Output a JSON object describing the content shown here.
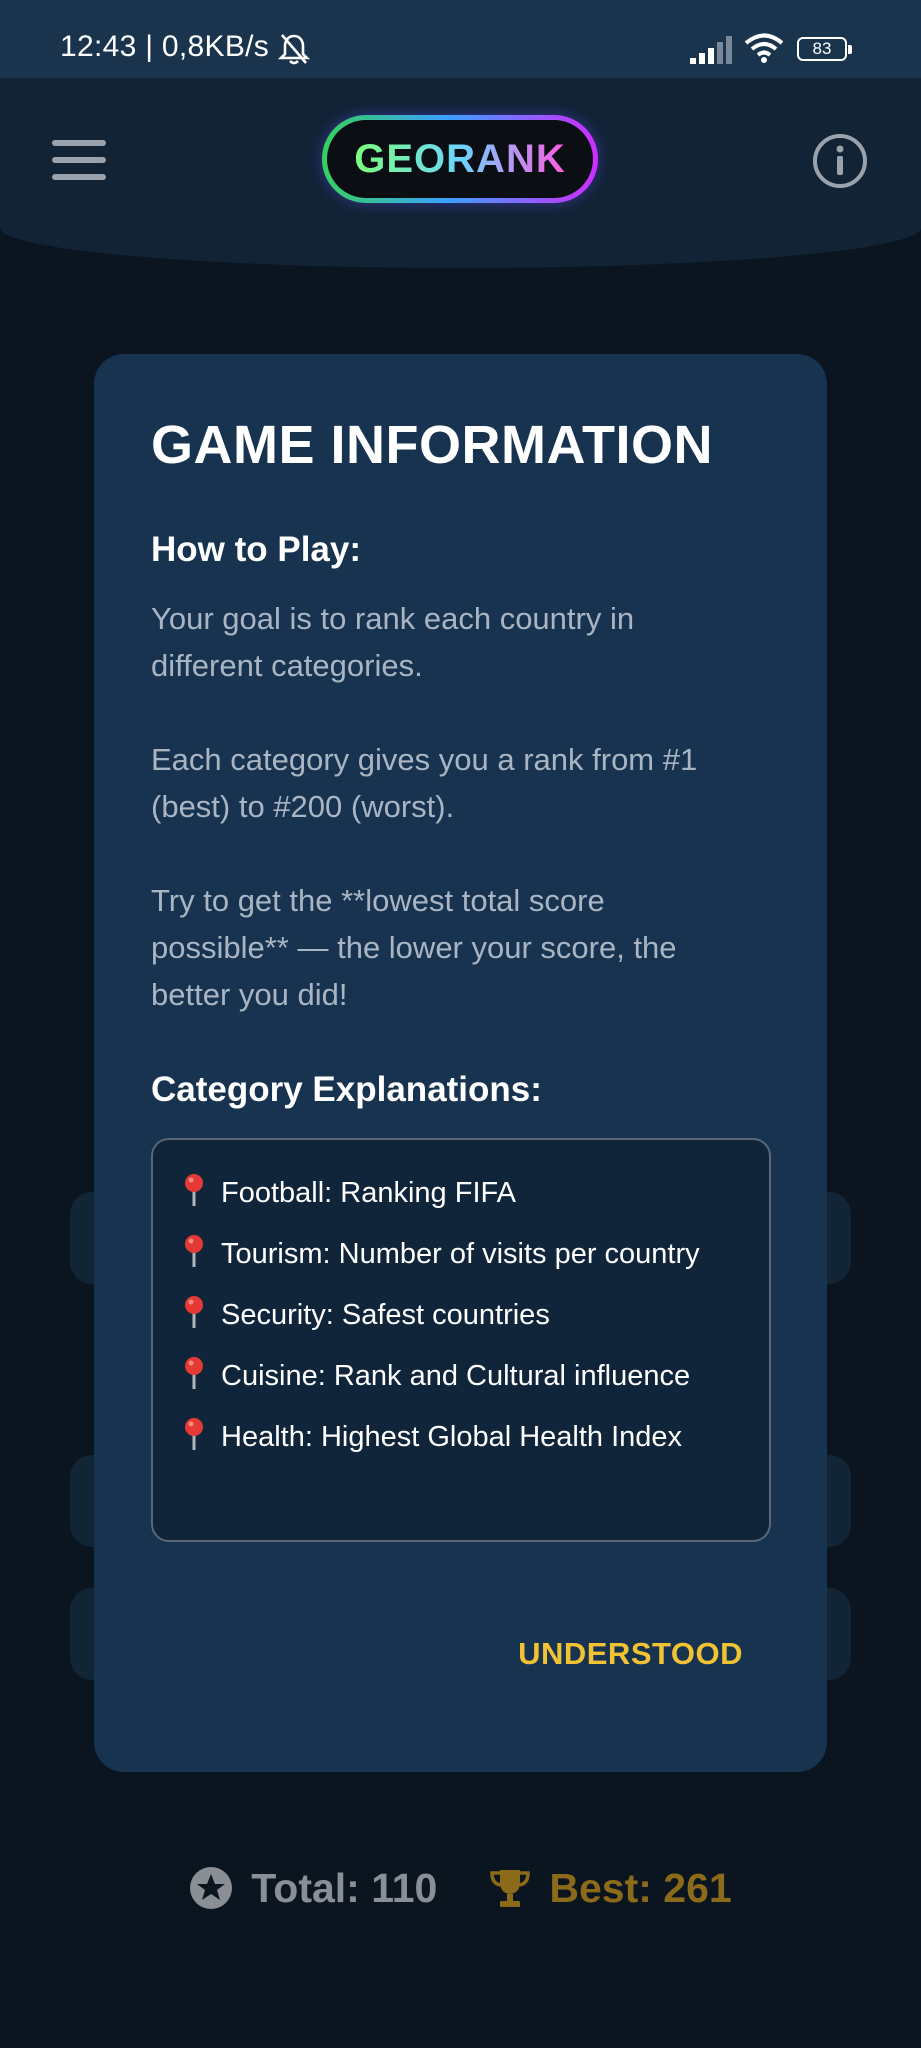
{
  "status_bar": {
    "time_speed": "12:43 | 0,8KB/s",
    "battery": "83"
  },
  "header": {
    "logo_text": "GEORANK"
  },
  "dialog": {
    "title": "GAME INFORMATION",
    "how_to_play_heading": "How to Play:",
    "paragraphs": [
      "Your goal is to rank each country in different categories.",
      "Each category gives you a rank from #1 (best) to #200 (worst).",
      "Try to get the **lowest total score possible** — the lower your score, the better you did!"
    ],
    "categories_heading": "Category Explanations:",
    "categories": [
      "Football: Ranking FIFA",
      "Tourism: Number of visits per country",
      "Security: Safest countries",
      "Cuisine: Rank and Cultural influence",
      "Health: Highest Global Health Index"
    ],
    "confirm_button": "UNDERSTOOD"
  },
  "footer": {
    "total": "Total: 110",
    "best": "Best: 261"
  },
  "colors": {
    "background": "#0a1520",
    "dialog": "#173350",
    "accent": "#f1c232"
  }
}
